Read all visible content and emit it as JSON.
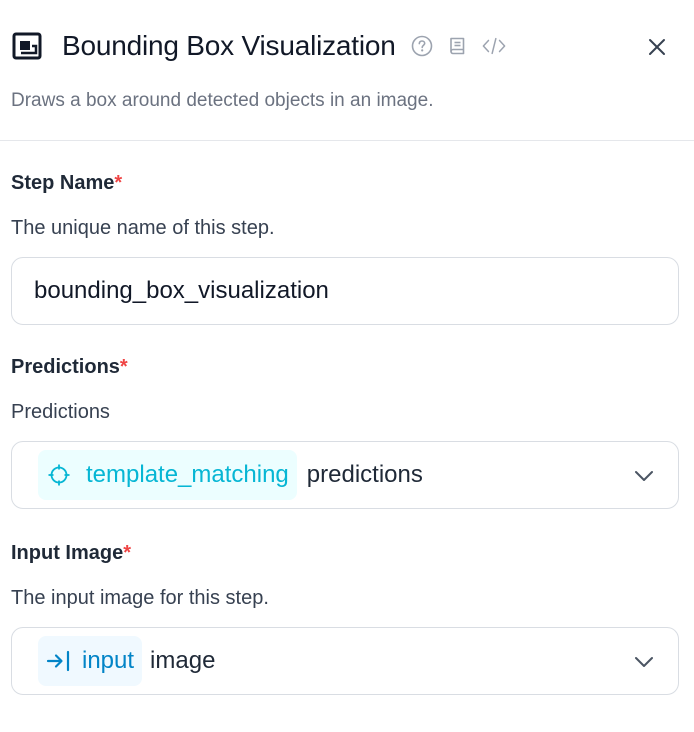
{
  "header": {
    "title": "Bounding Box Visualization",
    "subtitle": "Draws a box around detected objects in an image.",
    "icons": [
      "bounding-box-icon",
      "help-circle-icon",
      "book-icon",
      "code-icon",
      "close-icon"
    ]
  },
  "fields": {
    "step_name": {
      "label": "Step Name",
      "required_mark": "*",
      "description": "The unique name of this step.",
      "value": "bounding_box_visualization"
    },
    "predictions": {
      "label": "Predictions",
      "required_mark": "*",
      "description": "Predictions",
      "chip_label": "template_matching",
      "chip_icon": "crosshair-icon",
      "selected_property": "predictions"
    },
    "input_image": {
      "label": "Input Image",
      "required_mark": "*",
      "description": "The input image for this step.",
      "chip_label": "input",
      "chip_icon": "enter-arrow-icon",
      "selected_property": "image"
    }
  },
  "colors": {
    "required": "#ef4444",
    "chip_teal_text": "#06b6d4",
    "chip_teal_bg": "#ecfeff",
    "chip_blue_text": "#0284c7",
    "chip_blue_bg": "#f0f9ff",
    "border": "#d9dde3"
  }
}
